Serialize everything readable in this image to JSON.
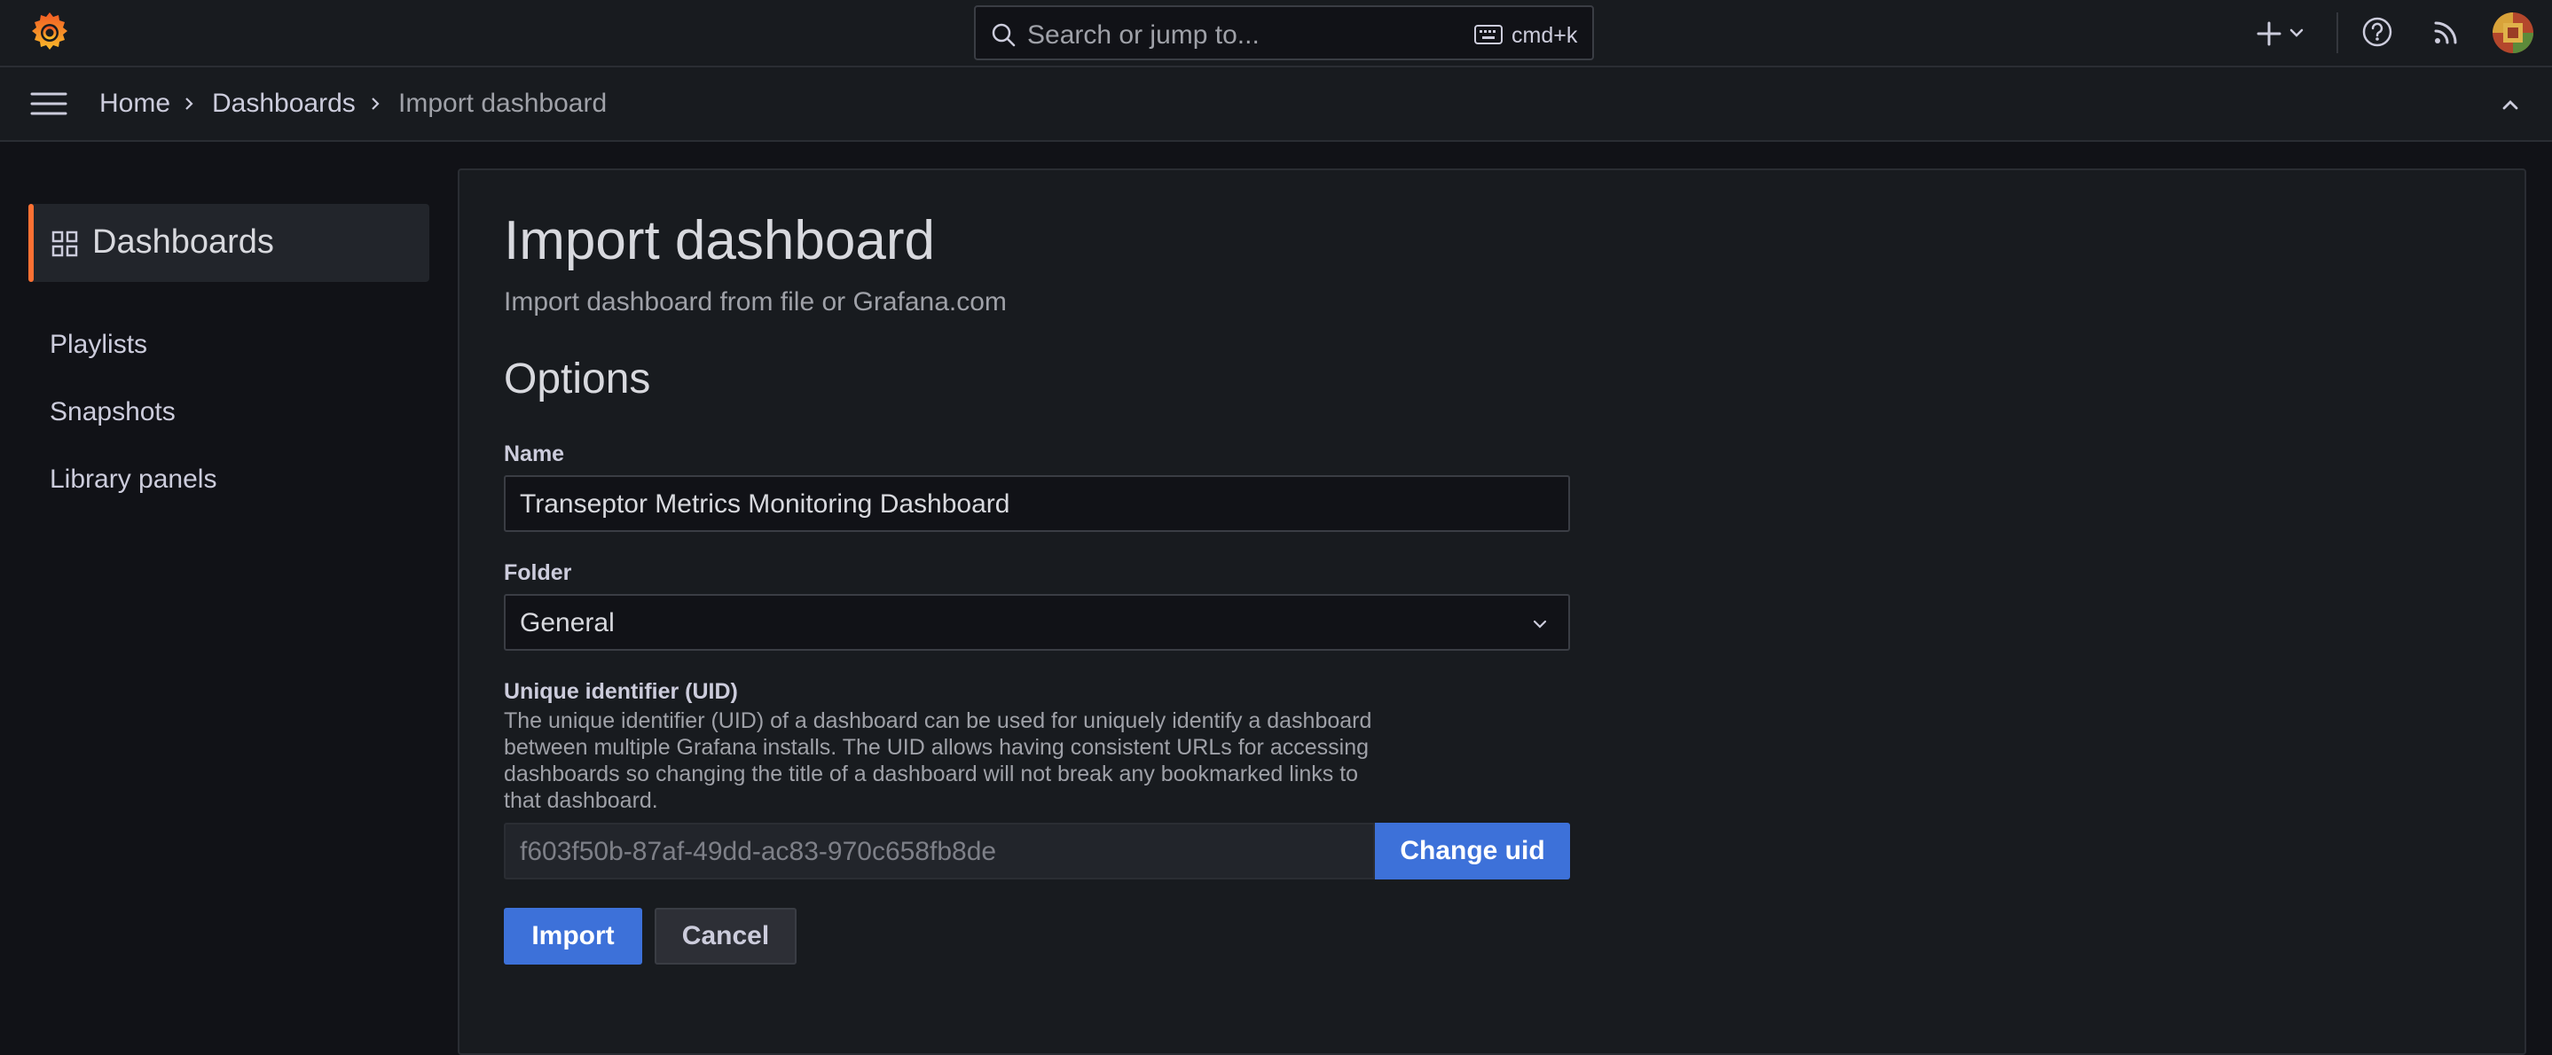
{
  "topbar": {
    "search_placeholder": "Search or jump to...",
    "search_shortcut": "cmd+k",
    "icons": [
      "grafana-logo-icon",
      "search-icon",
      "keyboard-icon",
      "plus-icon",
      "chevron-down-icon",
      "help-icon",
      "rss-icon",
      "avatar"
    ]
  },
  "breadcrumb": {
    "items": [
      {
        "label": "Home"
      },
      {
        "label": "Dashboards"
      },
      {
        "label": "Import dashboard"
      }
    ]
  },
  "sidebar": {
    "section_title": "Dashboards",
    "items": [
      {
        "label": "Playlists"
      },
      {
        "label": "Snapshots"
      },
      {
        "label": "Library panels"
      }
    ]
  },
  "main": {
    "title": "Import dashboard",
    "subtitle": "Import dashboard from file or Grafana.com",
    "options_heading": "Options",
    "name_label": "Name",
    "name_value": "Transeptor Metrics Monitoring Dashboard",
    "folder_label": "Folder",
    "folder_value": "General",
    "uid_label": "Unique identifier (UID)",
    "uid_description": "The unique identifier (UID) of a dashboard can be used for uniquely identify a dashboard between multiple Grafana installs. The UID allows having consistent URLs for accessing dashboards so changing the title of a dashboard will not break any bookmarked links to that dashboard.",
    "uid_value": "f603f50b-87af-49dd-ac83-970c658fb8de",
    "change_uid_label": "Change uid",
    "import_label": "Import",
    "cancel_label": "Cancel"
  },
  "colors": {
    "accent_orange": "#ff7133",
    "primary_blue": "#3d71d9",
    "background": "#111217",
    "panel": "#181b1f"
  }
}
